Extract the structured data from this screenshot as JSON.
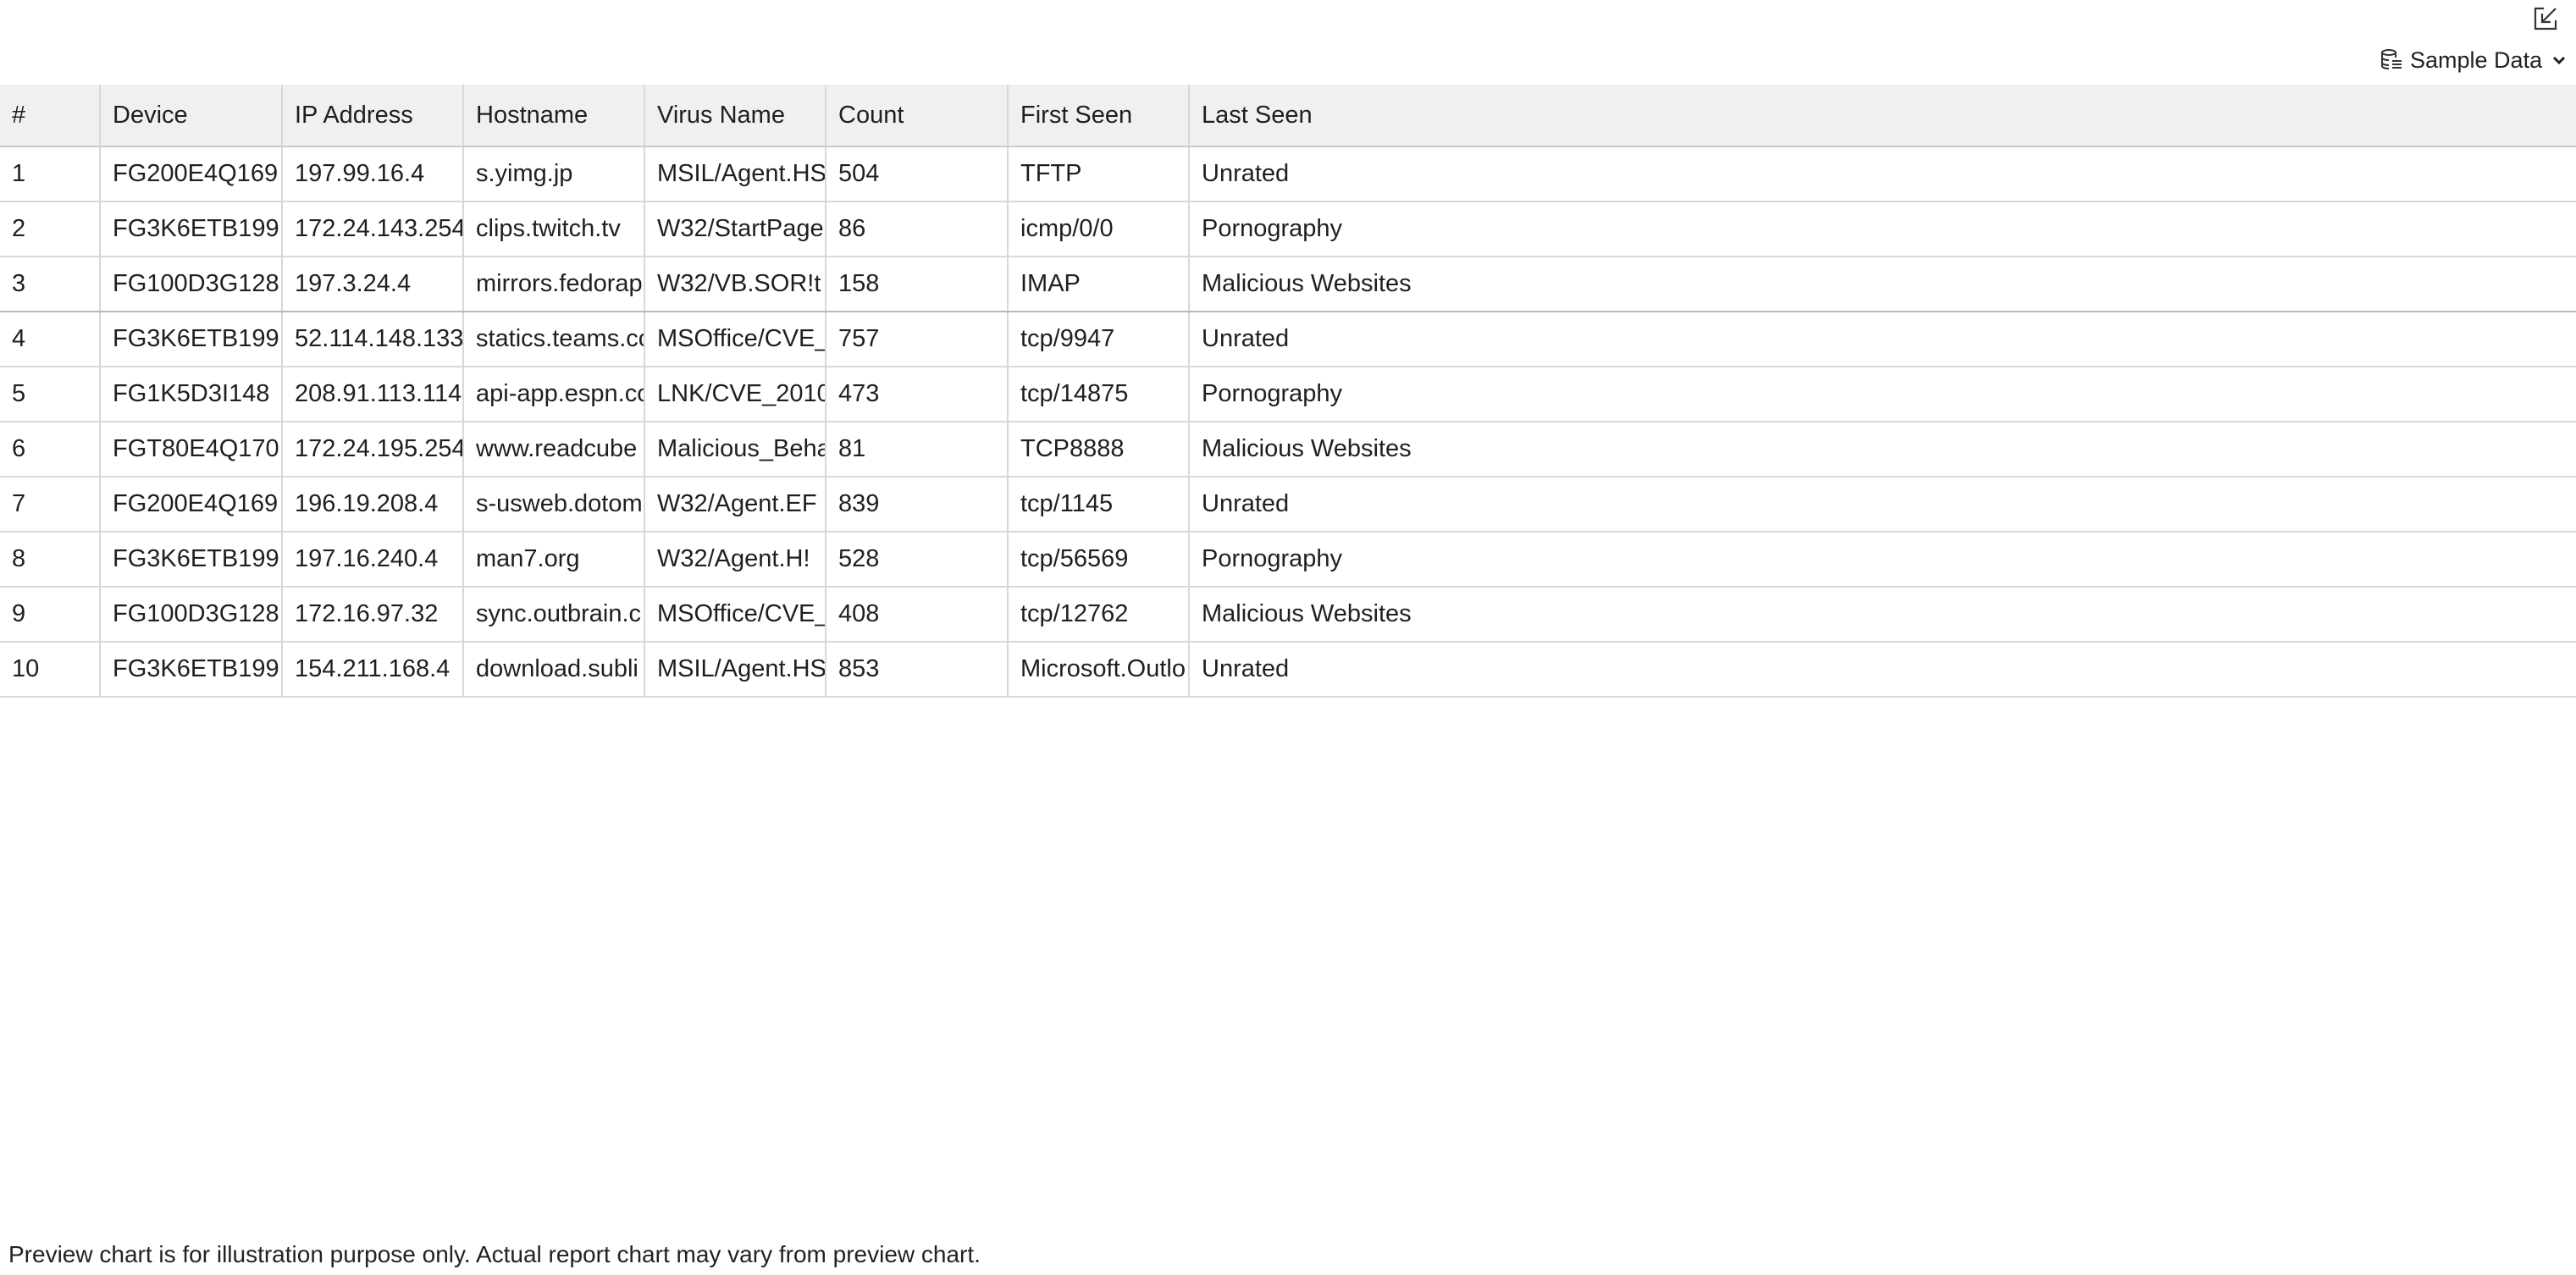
{
  "toolbar": {
    "export_icon": "export-arrow-icon",
    "sample_data_label": "Sample Data",
    "sample_data_icon": "database-icon",
    "dropdown_icon": "chevron-down-icon"
  },
  "table": {
    "columns": [
      "#",
      "Device",
      "IP Address",
      "Hostname",
      "Virus Name",
      "Count",
      "First Seen",
      "Last Seen"
    ],
    "rows": [
      [
        "1",
        "FG200E4Q169",
        "197.99.16.4",
        "s.yimg.jp",
        "MSIL/Agent.HS",
        "504",
        "TFTP",
        "Unrated"
      ],
      [
        "2",
        "FG3K6ETB199",
        "172.24.143.254",
        "clips.twitch.tv",
        "W32/StartPage",
        "86",
        "icmp/0/0",
        "Pornography"
      ],
      [
        "3",
        "FG100D3G128",
        "197.3.24.4",
        "mirrors.fedorap",
        "W32/VB.SOR!t",
        "158",
        "IMAP",
        "Malicious Websites"
      ],
      [
        "4",
        "FG3K6ETB199",
        "52.114.148.133",
        "statics.teams.co",
        "MSOffice/CVE_",
        "757",
        "tcp/9947",
        "Unrated"
      ],
      [
        "5",
        "FG1K5D3I148",
        "208.91.113.114",
        "api-app.espn.co",
        "LNK/CVE_2010",
        "473",
        "tcp/14875",
        "Pornography"
      ],
      [
        "6",
        "FGT80E4Q170",
        "172.24.195.254",
        "www.readcube",
        "Malicious_Beha",
        "81",
        "TCP8888",
        "Malicious Websites"
      ],
      [
        "7",
        "FG200E4Q169",
        "196.19.208.4",
        "s-usweb.dotom",
        "W32/Agent.EF",
        "839",
        "tcp/1145",
        "Unrated"
      ],
      [
        "8",
        "FG3K6ETB199",
        "197.16.240.4",
        "man7.org",
        "W32/Agent.H!",
        "528",
        "tcp/56569",
        "Pornography"
      ],
      [
        "9",
        "FG100D3G128",
        "172.16.97.32",
        "sync.outbrain.c",
        "MSOffice/CVE_",
        "408",
        "tcp/12762",
        "Malicious Websites"
      ],
      [
        "10",
        "FG3K6ETB199",
        "154.211.168.4",
        "download.subli",
        "MSIL/Agent.HS",
        "853",
        "Microsoft.Outlo",
        "Unrated"
      ]
    ]
  },
  "footnote": "Preview chart is for illustration purpose only. Actual report chart may vary from preview chart."
}
